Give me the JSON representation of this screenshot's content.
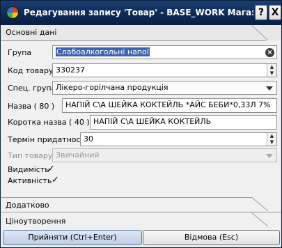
{
  "window": {
    "title": "Редагування запису 'Товар' - BASE_WORK Магазин \"ПК",
    "help_label": "?",
    "close_label": "X"
  },
  "sections": {
    "main": "Основні дані",
    "extra": "Додатково",
    "pricing": "Ціноутворення"
  },
  "form": {
    "group": {
      "label": "Група",
      "value": "Слабоалкогольні напої"
    },
    "code": {
      "label": "Код товару",
      "value": "330237"
    },
    "spec_group": {
      "label": "Спец. група",
      "value": "Лікеро-горілчана  продукція"
    },
    "name80": {
      "label": "Назва ( 80 )",
      "value": "НАПІЙ С\\А ШЕЙКА КОКТЕЙЛЬ *АЙС БЕБИ*0,33Л 7%"
    },
    "name40": {
      "label": "Коротка назва ( 40 )",
      "value": "НАПІЙ С\\А ШЕЙКА КОКТЕЙЛЬ"
    },
    "shelf_life": {
      "label": "Термін придатності",
      "value": "30"
    },
    "item_type": {
      "label": "Тип товару",
      "value": "Звичайний"
    },
    "visibility": {
      "label": "Видимість",
      "checked": true,
      "mark": "✓"
    },
    "activity": {
      "label": "Активність",
      "checked": true,
      "mark": "✓"
    }
  },
  "buttons": {
    "accept": "Прийняти (Ctrl+Enter)",
    "cancel": "Відмова (Esc)"
  }
}
